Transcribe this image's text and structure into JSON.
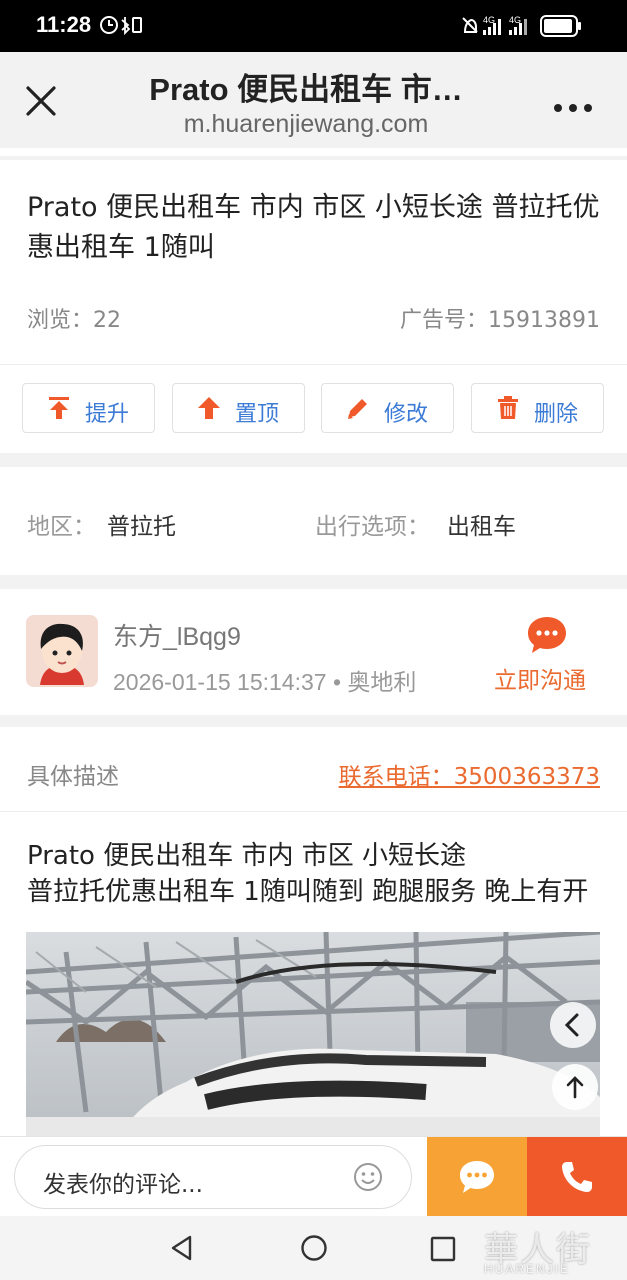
{
  "status_bar": {
    "time": "11:28",
    "network_1": "4G",
    "network_2": "4G"
  },
  "browser": {
    "title": "Prato 便民出租车 市…",
    "url": "m.huarenjiewang.com"
  },
  "post": {
    "title": "Prato 便民出租车 市内 市区 小短长途 普拉托优惠出租车 1随叫",
    "views_label": "浏览：",
    "views": "22",
    "ad_label": "广告号：",
    "ad_no": "15913891"
  },
  "actions": [
    {
      "label": "提升",
      "icon": "promote-icon"
    },
    {
      "label": "置顶",
      "icon": "pin-top-icon"
    },
    {
      "label": "修改",
      "icon": "edit-icon"
    },
    {
      "label": "删除",
      "icon": "trash-icon"
    }
  ],
  "info": {
    "region_label": "地区：",
    "region": "普拉托",
    "travel_label": "出行选项：",
    "travel": "出租车"
  },
  "user": {
    "name": "东方_lBqg9",
    "datetime_location": "2026-01-15 15:14:37 • 奥地利",
    "chat_label": "立即沟通"
  },
  "description": {
    "heading": "具体描述",
    "phone": "联系电话：3500363373",
    "line1": "Prato 便民出租车 市内 市区 小短长途",
    "line2": "普拉托优惠出租车 1随叫随到 跑腿服务 晚上有开"
  },
  "comment": {
    "placeholder": "发表你的评论..."
  },
  "watermark": {
    "cn": "華人街",
    "en": "HUARENJIE"
  },
  "colors": {
    "accent": "#ea6a2f",
    "link_blue": "#3c7bd6",
    "chat_button": "#f7a234",
    "call_button": "#f05a2a"
  }
}
